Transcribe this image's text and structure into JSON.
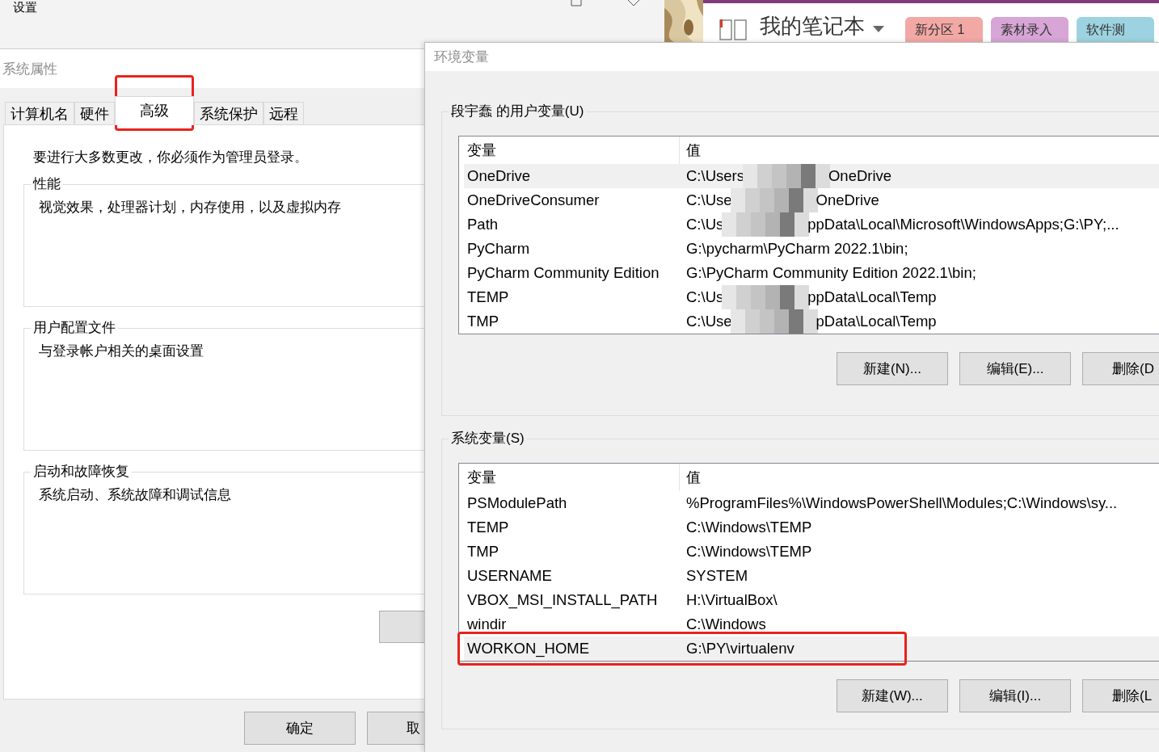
{
  "settings_window": {
    "title": "设置"
  },
  "notebook": {
    "title": "我的笔记本",
    "sections": [
      {
        "label": "新分区 1",
        "color": "#f2a8a4"
      },
      {
        "label": "素材录入",
        "color": "#d7a5d6"
      },
      {
        "label": "软件测",
        "color": "#9dd3e0"
      }
    ]
  },
  "system_properties": {
    "title": "系统属性",
    "tabs": [
      {
        "label": "计算机名",
        "selected": false,
        "annotated": false
      },
      {
        "label": "硬件",
        "selected": false,
        "annotated": false
      },
      {
        "label": "高级",
        "selected": true,
        "annotated": true
      },
      {
        "label": "系统保护",
        "selected": false,
        "annotated": false
      },
      {
        "label": "远程",
        "selected": false,
        "annotated": false
      }
    ],
    "notice": "要进行大多数更改，你必须作为管理员登录。",
    "groups": [
      {
        "title": "性能",
        "description": "视觉效果，处理器计划，内存使用，以及虚拟内存"
      },
      {
        "title": "用户配置文件",
        "description": "与登录帐户相关的桌面设置"
      },
      {
        "title": "启动和故障恢复",
        "description": "系统启动、系统故障和调试信息"
      }
    ],
    "buttons": [
      "确定",
      "取"
    ]
  },
  "environment_variables": {
    "title": "环境变量",
    "sections": [
      {
        "title": "段宇蠢 的用户变量(U)",
        "columns": [
          "变量",
          "值"
        ],
        "rows": [
          {
            "name": "OneDrive",
            "value": "C:\\Users",
            "value_after": "OneDrive",
            "redacted": true,
            "selected": true,
            "annotated": false
          },
          {
            "name": "OneDriveConsumer",
            "value": "C:\\Use",
            "value_after": "OneDrive",
            "redacted": true,
            "selected": false,
            "annotated": false
          },
          {
            "name": "Path",
            "value": "C:\\Us",
            "value_after": "ppData\\Local\\Microsoft\\WindowsApps;G:\\PY;...",
            "redacted": true,
            "selected": false,
            "annotated": false
          },
          {
            "name": "PyCharm",
            "value": "G:\\pycharm\\PyCharm 2022.1\\bin;",
            "redacted": false,
            "selected": false,
            "annotated": false
          },
          {
            "name": "PyCharm Community Edition",
            "value": "G:\\PyCharm Community Edition 2022.1\\bin;",
            "redacted": false,
            "selected": false,
            "annotated": false
          },
          {
            "name": "TEMP",
            "value": "C:\\Us",
            "value_after": "ppData\\Local\\Temp",
            "redacted": true,
            "selected": false,
            "annotated": false
          },
          {
            "name": "TMP",
            "value": "C:\\Use",
            "value_after": "pData\\Local\\Temp",
            "redacted": true,
            "selected": false,
            "annotated": false
          }
        ],
        "buttons": [
          "新建(N)...",
          "编辑(E)...",
          "删除(D"
        ]
      },
      {
        "title": "系统变量(S)",
        "columns": [
          "变量",
          "值"
        ],
        "rows": [
          {
            "name": "PSModulePath",
            "value": "%ProgramFiles%\\WindowsPowerShell\\Modules;C:\\Windows\\sy...",
            "redacted": false,
            "selected": false,
            "annotated": false
          },
          {
            "name": "TEMP",
            "value": "C:\\Windows\\TEMP",
            "redacted": false,
            "selected": false,
            "annotated": false
          },
          {
            "name": "TMP",
            "value": "C:\\Windows\\TEMP",
            "redacted": false,
            "selected": false,
            "annotated": false
          },
          {
            "name": "USERNAME",
            "value": "SYSTEM",
            "redacted": false,
            "selected": false,
            "annotated": false
          },
          {
            "name": "VBOX_MSI_INSTALL_PATH",
            "value": "H:\\VirtualBox\\",
            "redacted": false,
            "selected": false,
            "annotated": false
          },
          {
            "name": "windir",
            "value": "C:\\Windows",
            "redacted": false,
            "selected": false,
            "annotated": false
          },
          {
            "name": "WORKON_HOME",
            "value": "G:\\PY\\virtualenv",
            "redacted": false,
            "selected": true,
            "annotated": true
          }
        ],
        "buttons": [
          "新建(W)...",
          "编辑(I)...",
          "删除(L"
        ]
      }
    ]
  }
}
